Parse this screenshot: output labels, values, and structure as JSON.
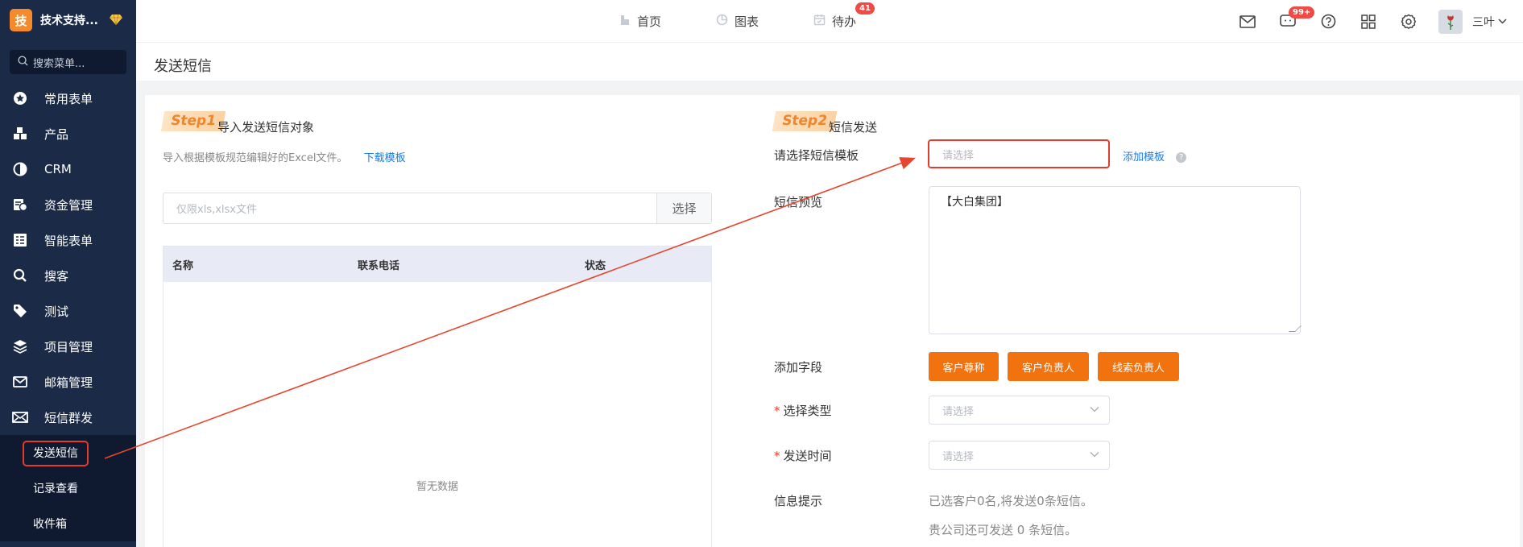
{
  "brand": {
    "logo_char": "技",
    "name": "技术支持...",
    "badge_icon": "diamond-icon"
  },
  "sidebar": {
    "search_placeholder": "搜索菜单...",
    "items": [
      {
        "label": "常用表单",
        "icon": "star-circle-icon"
      },
      {
        "label": "产品",
        "icon": "boxes-icon"
      },
      {
        "label": "CRM",
        "icon": "pie-icon"
      },
      {
        "label": "资金管理",
        "icon": "money-icon"
      },
      {
        "label": "智能表单",
        "icon": "form-icon"
      },
      {
        "label": "搜客",
        "icon": "search-icon"
      },
      {
        "label": "测试",
        "icon": "tag-icon"
      },
      {
        "label": "项目管理",
        "icon": "layers-icon"
      },
      {
        "label": "邮箱管理",
        "icon": "mail-icon"
      },
      {
        "label": "短信群发",
        "icon": "envelope-icon"
      }
    ],
    "subitems": [
      {
        "label": "发送短信",
        "active": true
      },
      {
        "label": "记录查看",
        "active": false
      },
      {
        "label": "收件箱",
        "active": false
      }
    ]
  },
  "topnav": {
    "items": [
      {
        "label": "首页",
        "icon": "home-icon"
      },
      {
        "label": "图表",
        "icon": "chart-icon"
      },
      {
        "label": "待办",
        "icon": "calendar-icon",
        "badge": "41"
      }
    ],
    "message_badge": "99+",
    "username": "三叶"
  },
  "page": {
    "title": "发送短信"
  },
  "step1": {
    "tag": "Step1",
    "title": "导入发送短信对象",
    "hint": "导入根据模板规范编辑好的Excel文件。",
    "download_link": "下载模板",
    "file_placeholder": "仅限xls,xlsx文件",
    "choose_button": "选择",
    "table_headers": [
      "名称",
      "联系电话",
      "状态"
    ],
    "empty_text": "暂无数据"
  },
  "step2": {
    "tag": "Step2",
    "title": "短信发送",
    "template_label": "请选择短信模板",
    "template_placeholder": "请选择",
    "add_template_link": "添加模板",
    "preview_label": "短信预览",
    "preview_text": "【大白集团】",
    "add_field_label": "添加字段",
    "field_buttons": [
      "客户尊称",
      "客户负责人",
      "线索负责人"
    ],
    "type_label": "选择类型",
    "type_placeholder": "请选择",
    "time_label": "发送时间",
    "time_placeholder": "请选择",
    "info_label": "信息提示",
    "info_line1": "已选客户0名,将发送0条短信。",
    "info_line2": "贵公司还可发送 0 条短信。"
  },
  "colors": {
    "sidebar_bg": "#1b2a47",
    "accent_orange": "#f2720f",
    "highlight_red": "#e53b2a",
    "link_blue": "#1e7be0"
  }
}
